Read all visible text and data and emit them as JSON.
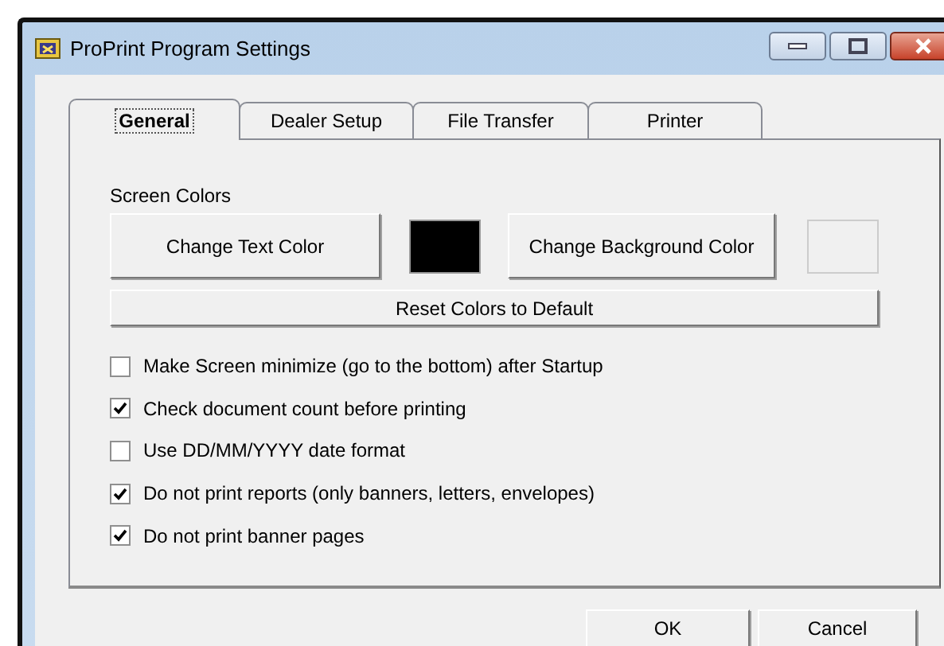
{
  "window": {
    "title": "ProPrint Program Settings"
  },
  "tabs": [
    {
      "label": "General",
      "selected": true
    },
    {
      "label": "Dealer Setup",
      "selected": false
    },
    {
      "label": "File Transfer",
      "selected": false
    },
    {
      "label": "Printer",
      "selected": false
    }
  ],
  "section_label": "Screen Colors",
  "color_buttons": [
    {
      "label": "Change Text Color",
      "color": "#000000"
    },
    {
      "label": "Change Background Color",
      "color": "#f0f0f0"
    }
  ],
  "reset_button": "Reset Colors to Default",
  "options": [
    {
      "label": "Make Screen minimize (go to the bottom) after Startup",
      "checked": false
    },
    {
      "label": "Check document count before printing",
      "checked": true
    },
    {
      "label": "Use DD/MM/YYYY date format",
      "checked": false
    },
    {
      "label": "Do not print reports (only banners, letters, envelopes)",
      "checked": true
    },
    {
      "label": "Do not print banner pages",
      "checked": true
    }
  ],
  "buttons": [
    "OK",
    "Cancel"
  ]
}
